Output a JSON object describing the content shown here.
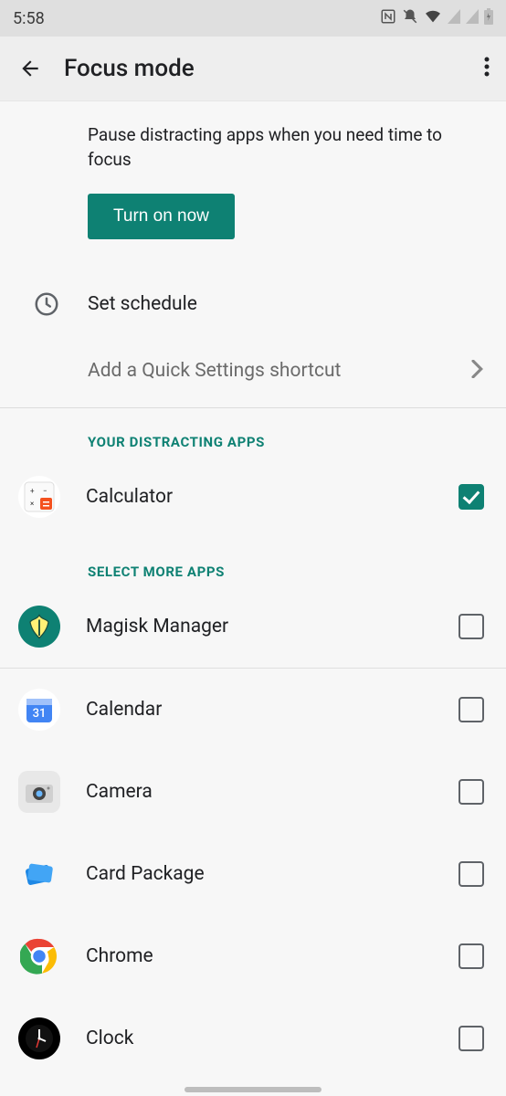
{
  "status": {
    "time": "5:58"
  },
  "header": {
    "title": "Focus mode"
  },
  "description": "Pause distracting apps when you need time to focus",
  "turn_on": "Turn on now",
  "set_schedule": "Set schedule",
  "add_shortcut": "Add a Quick Settings shortcut",
  "section_your": "YOUR DISTRACTING APPS",
  "section_more": "SELECT MORE APPS",
  "apps_selected": [
    {
      "name": "Calculator",
      "checked": true
    }
  ],
  "apps_more": [
    {
      "name": "Magisk Manager",
      "checked": false
    },
    {
      "name": "Calendar",
      "checked": false
    },
    {
      "name": "Camera",
      "checked": false
    },
    {
      "name": "Card Package",
      "checked": false
    },
    {
      "name": "Chrome",
      "checked": false
    },
    {
      "name": "Clock",
      "checked": false
    }
  ],
  "colors": {
    "accent": "#0e8173"
  }
}
